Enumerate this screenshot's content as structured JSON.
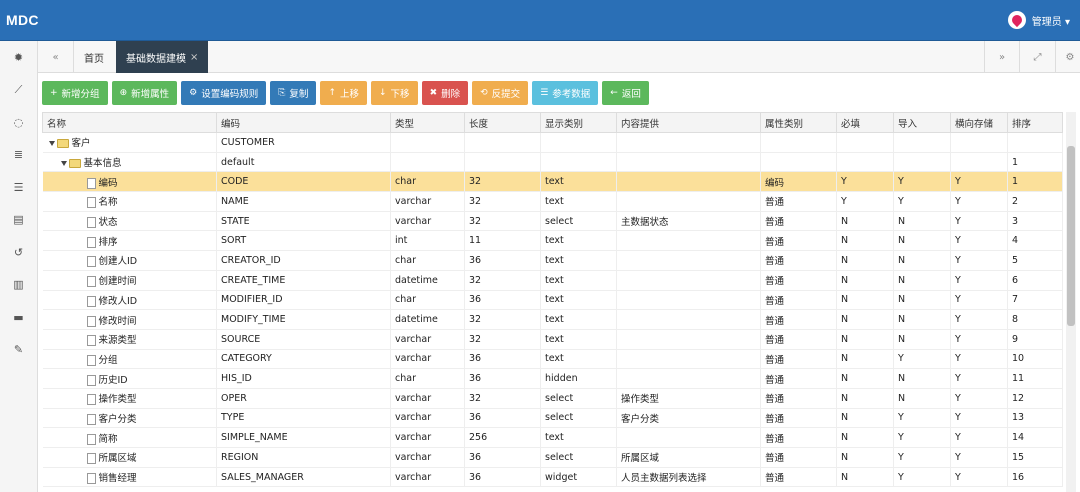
{
  "app": {
    "logo": "MDC",
    "user": "管理员 ▾"
  },
  "sidebar": {
    "icons": [
      "dashboard-icon",
      "chart-icon",
      "loading-icon",
      "database-icon",
      "list-icon",
      "card-icon",
      "history-icon",
      "film-icon",
      "box-icon",
      "wrench-icon"
    ]
  },
  "tabs": [
    {
      "label": "首页"
    },
    {
      "label": "基础数据建模"
    }
  ],
  "toolbar": [
    {
      "label": "新增分组",
      "icon": "+",
      "color": "g"
    },
    {
      "label": "新增属性",
      "icon": "⊕",
      "color": "g"
    },
    {
      "label": "设置编码规则",
      "icon": "⚙",
      "color": "b"
    },
    {
      "label": "复制",
      "icon": "⎘",
      "color": "b"
    },
    {
      "label": "上移",
      "icon": "↑",
      "color": "o"
    },
    {
      "label": "下移",
      "icon": "↓",
      "color": "o"
    },
    {
      "label": "删除",
      "icon": "✖",
      "color": "r"
    },
    {
      "label": "反提交",
      "icon": "⟲",
      "color": "o"
    },
    {
      "label": "参考数据",
      "icon": "☰",
      "color": "c"
    },
    {
      "label": "返回",
      "icon": "←",
      "color": "g"
    }
  ],
  "table": {
    "columns": [
      "名称",
      "编码",
      "类型",
      "长度",
      "显示类别",
      "内容提供",
      "属性类别",
      "必填",
      "导入",
      "横向存储",
      "排序"
    ],
    "tree": [
      {
        "name": "客户",
        "code": "CUSTOMER",
        "level": 0
      },
      {
        "name": "基本信息",
        "code": "default",
        "level": 1,
        "sort": "1"
      }
    ],
    "rows": [
      [
        "编码",
        "CODE",
        "char",
        "32",
        "text",
        "",
        "编码",
        "Y",
        "Y",
        "Y",
        "1"
      ],
      [
        "名称",
        "NAME",
        "varchar",
        "32",
        "text",
        "",
        "普通",
        "Y",
        "Y",
        "Y",
        "2"
      ],
      [
        "状态",
        "STATE",
        "varchar",
        "32",
        "select",
        "主数据状态",
        "普通",
        "N",
        "N",
        "Y",
        "3"
      ],
      [
        "排序",
        "SORT",
        "int",
        "11",
        "text",
        "",
        "普通",
        "N",
        "N",
        "Y",
        "4"
      ],
      [
        "创建人ID",
        "CREATOR_ID",
        "char",
        "36",
        "text",
        "",
        "普通",
        "N",
        "N",
        "Y",
        "5"
      ],
      [
        "创建时间",
        "CREATE_TIME",
        "datetime",
        "32",
        "text",
        "",
        "普通",
        "N",
        "N",
        "Y",
        "6"
      ],
      [
        "修改人ID",
        "MODIFIER_ID",
        "char",
        "36",
        "text",
        "",
        "普通",
        "N",
        "N",
        "Y",
        "7"
      ],
      [
        "修改时间",
        "MODIFY_TIME",
        "datetime",
        "32",
        "text",
        "",
        "普通",
        "N",
        "N",
        "Y",
        "8"
      ],
      [
        "来源类型",
        "SOURCE",
        "varchar",
        "32",
        "text",
        "",
        "普通",
        "N",
        "N",
        "Y",
        "9"
      ],
      [
        "分组",
        "CATEGORY",
        "varchar",
        "36",
        "text",
        "",
        "普通",
        "N",
        "Y",
        "Y",
        "10"
      ],
      [
        "历史ID",
        "HIS_ID",
        "char",
        "36",
        "hidden",
        "",
        "普通",
        "N",
        "N",
        "Y",
        "11"
      ],
      [
        "操作类型",
        "OPER",
        "varchar",
        "32",
        "select",
        "操作类型",
        "普通",
        "N",
        "N",
        "Y",
        "12"
      ],
      [
        "客户分类",
        "TYPE",
        "varchar",
        "36",
        "select",
        "客户分类",
        "普通",
        "N",
        "Y",
        "Y",
        "13"
      ],
      [
        "简称",
        "SIMPLE_NAME",
        "varchar",
        "256",
        "text",
        "",
        "普通",
        "N",
        "Y",
        "Y",
        "14"
      ],
      [
        "所属区域",
        "REGION",
        "varchar",
        "36",
        "select",
        "所属区域",
        "普通",
        "N",
        "Y",
        "Y",
        "15"
      ],
      [
        "销售经理",
        "SALES_MANAGER",
        "varchar",
        "36",
        "widget",
        "人员主数据列表选择",
        "普通",
        "N",
        "Y",
        "Y",
        "16"
      ]
    ]
  }
}
